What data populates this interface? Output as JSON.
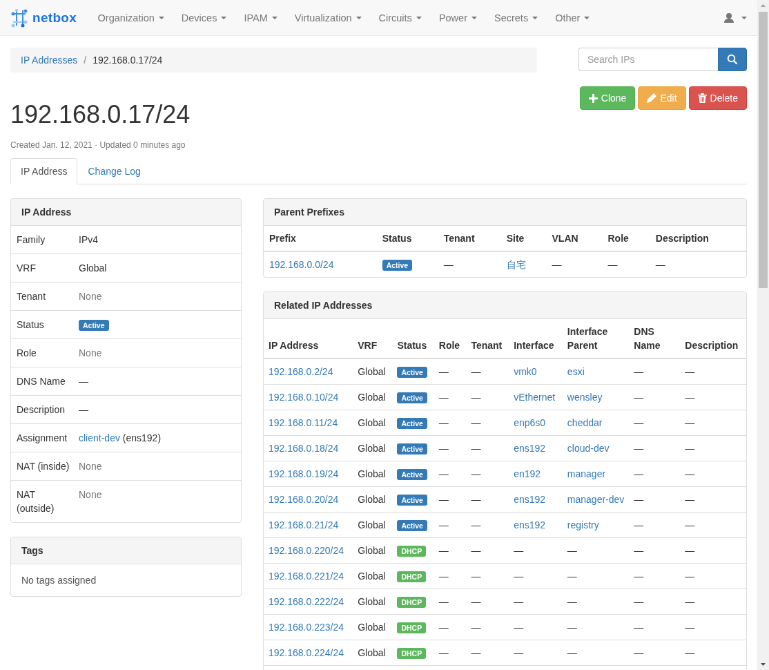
{
  "navbar": {
    "brand": "netbox",
    "menus": [
      "Organization",
      "Devices",
      "IPAM",
      "Virtualization",
      "Circuits",
      "Power",
      "Secrets",
      "Other"
    ]
  },
  "breadcrumb": {
    "parent": "IP Addresses",
    "separator": "/",
    "current": "192.168.0.17/24"
  },
  "search": {
    "placeholder": "Search IPs"
  },
  "actions": [
    {
      "kind": "clone",
      "label": "Clone"
    },
    {
      "kind": "edit",
      "label": "Edit"
    },
    {
      "kind": "delete",
      "label": "Delete"
    }
  ],
  "title": "192.168.0.17/24",
  "meta": "Created Jan. 12, 2021 · Updated 0 minutes ago",
  "tabs": [
    {
      "label": "IP Address",
      "selected": true
    },
    {
      "label": "Change Log",
      "selected": false
    }
  ],
  "ip_panel": {
    "title": "IP Address",
    "rows": [
      {
        "label": "Family",
        "kind": "text",
        "value": "IPv4"
      },
      {
        "label": "VRF",
        "kind": "text",
        "value": "Global"
      },
      {
        "label": "Tenant",
        "kind": "muted",
        "value": "None"
      },
      {
        "label": "Status",
        "kind": "badge",
        "value": "Active",
        "color": "#337ab7"
      },
      {
        "label": "Role",
        "kind": "muted",
        "value": "None"
      },
      {
        "label": "DNS Name",
        "kind": "text",
        "value": "—"
      },
      {
        "label": "Description",
        "kind": "text",
        "value": "—"
      },
      {
        "label": "Assignment",
        "kind": "link",
        "value": "client-dev",
        "suffix": "(ens192)"
      },
      {
        "label": "NAT (inside)",
        "kind": "muted",
        "value": "None"
      },
      {
        "label": "NAT (outside)",
        "kind": "muted",
        "value": "None"
      }
    ]
  },
  "tags_panel": {
    "title": "Tags",
    "empty": "No tags assigned"
  },
  "parent_prefixes": {
    "title": "Parent Prefixes",
    "columns": [
      "Prefix",
      "Status",
      "Tenant",
      "Site",
      "VLAN",
      "Role",
      "Description"
    ],
    "rows": [
      {
        "prefix": "192.168.0.0/24",
        "status": "Active",
        "color": "#337ab7",
        "tenant": "—",
        "site": "自宅",
        "vlan": "—",
        "role": "—",
        "description": "—"
      }
    ]
  },
  "related": {
    "title": "Related IP Addresses",
    "columns": [
      "IP Address",
      "VRF",
      "Status",
      "Role",
      "Tenant",
      "Interface",
      "Interface Parent",
      "DNS Name",
      "Description"
    ],
    "rows": [
      {
        "address": "192.168.0.2/24",
        "vrf": "Global",
        "status": "Active",
        "color": "#337ab7",
        "role": "—",
        "tenant": "—",
        "assigned": true,
        "interface": "vmk0",
        "parent": "esxi",
        "dns": "—",
        "description": "—"
      },
      {
        "address": "192.168.0.10/24",
        "vrf": "Global",
        "status": "Active",
        "color": "#337ab7",
        "role": "—",
        "tenant": "—",
        "assigned": true,
        "interface": "vEthernet",
        "parent": "wensley",
        "dns": "—",
        "description": "—"
      },
      {
        "address": "192.168.0.11/24",
        "vrf": "Global",
        "status": "Active",
        "color": "#337ab7",
        "role": "—",
        "tenant": "—",
        "assigned": true,
        "interface": "enp6s0",
        "parent": "cheddar",
        "dns": "—",
        "description": "—"
      },
      {
        "address": "192.168.0.18/24",
        "vrf": "Global",
        "status": "Active",
        "color": "#337ab7",
        "role": "—",
        "tenant": "—",
        "assigned": true,
        "interface": "ens192",
        "parent": "cloud-dev",
        "dns": "—",
        "description": "—"
      },
      {
        "address": "192.168.0.19/24",
        "vrf": "Global",
        "status": "Active",
        "color": "#337ab7",
        "role": "—",
        "tenant": "—",
        "assigned": true,
        "interface": "en192",
        "parent": "manager",
        "dns": "—",
        "description": "—"
      },
      {
        "address": "192.168.0.20/24",
        "vrf": "Global",
        "status": "Active",
        "color": "#337ab7",
        "role": "—",
        "tenant": "—",
        "assigned": true,
        "interface": "ens192",
        "parent": "manager-dev",
        "dns": "—",
        "description": "—"
      },
      {
        "address": "192.168.0.21/24",
        "vrf": "Global",
        "status": "Active",
        "color": "#337ab7",
        "role": "—",
        "tenant": "—",
        "assigned": true,
        "interface": "ens192",
        "parent": "registry",
        "dns": "—",
        "description": "—"
      },
      {
        "address": "192.168.0.220/24",
        "vrf": "Global",
        "status": "DHCP",
        "color": "#5cb85c",
        "role": "—",
        "tenant": "—",
        "assigned": false,
        "interface": "—",
        "parent": "—",
        "dns": "—",
        "description": "—"
      },
      {
        "address": "192.168.0.221/24",
        "vrf": "Global",
        "status": "DHCP",
        "color": "#5cb85c",
        "role": "—",
        "tenant": "—",
        "assigned": false,
        "interface": "—",
        "parent": "—",
        "dns": "—",
        "description": "—"
      },
      {
        "address": "192.168.0.222/24",
        "vrf": "Global",
        "status": "DHCP",
        "color": "#5cb85c",
        "role": "—",
        "tenant": "—",
        "assigned": false,
        "interface": "—",
        "parent": "—",
        "dns": "—",
        "description": "—"
      },
      {
        "address": "192.168.0.223/24",
        "vrf": "Global",
        "status": "DHCP",
        "color": "#5cb85c",
        "role": "—",
        "tenant": "—",
        "assigned": false,
        "interface": "—",
        "parent": "—",
        "dns": "—",
        "description": "—"
      },
      {
        "address": "192.168.0.224/24",
        "vrf": "Global",
        "status": "DHCP",
        "color": "#5cb85c",
        "role": "—",
        "tenant": "—",
        "assigned": false,
        "interface": "—",
        "parent": "—",
        "dns": "—",
        "description": "—"
      }
    ]
  }
}
